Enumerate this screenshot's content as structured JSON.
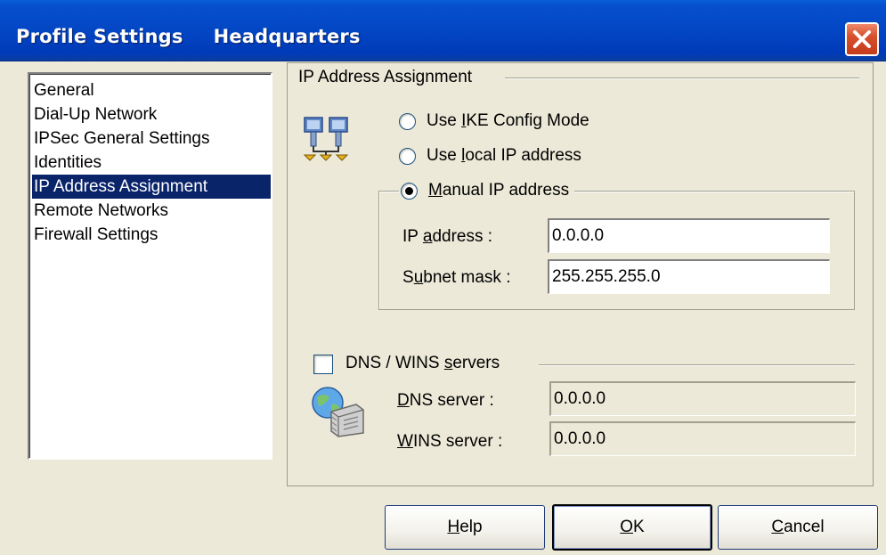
{
  "window": {
    "title_left": "Profile Settings",
    "title_right": "Headquarters",
    "close_label": "×"
  },
  "sidebar": {
    "items": [
      {
        "label": "General"
      },
      {
        "label": "Dial-Up Network"
      },
      {
        "label": "IPSec General Settings"
      },
      {
        "label": "Identities"
      },
      {
        "label": "IP Address Assignment",
        "selected": true
      },
      {
        "label": "Remote Networks"
      },
      {
        "label": "Firewall Settings"
      }
    ]
  },
  "group": {
    "title": "IP Address Assignment",
    "icon": "network-computers-icon"
  },
  "assignment": {
    "ike_pre": "Use ",
    "ike_key": "I",
    "ike_post": "KE Config Mode",
    "local_pre": "Use ",
    "local_key": "l",
    "local_post": "ocal IP address",
    "manual_key": "M",
    "manual_post": "anual IP address",
    "selected": "manual"
  },
  "manual": {
    "ip_label_pre": "IP ",
    "ip_label_key": "a",
    "ip_label_post": "ddress :",
    "ip_value": "0.0.0.0",
    "subnet_label_pre": "S",
    "subnet_label_key": "u",
    "subnet_label_post": "bnet mask :",
    "subnet_value": "255.255.255.0"
  },
  "dns_wins": {
    "checkbox_pre": "DNS / WINS ",
    "checkbox_key": "s",
    "checkbox_post": "ervers",
    "checked": false,
    "icon": "globe-server-icon",
    "dns_label_key": "D",
    "dns_label_post": "NS server :",
    "dns_value": "0.0.0.0",
    "wins_label_key": "W",
    "wins_label_post": "INS server :",
    "wins_value": "0.0.0.0"
  },
  "buttons": {
    "help_key": "H",
    "help_post": "elp",
    "ok_key": "O",
    "ok_post": "K",
    "cancel_key": "C",
    "cancel_post": "ancel"
  },
  "colors": {
    "titlebar": "#0346c4",
    "selection": "#0a246a",
    "dialog_bg": "#ece9d8",
    "close": "#d7502e"
  }
}
